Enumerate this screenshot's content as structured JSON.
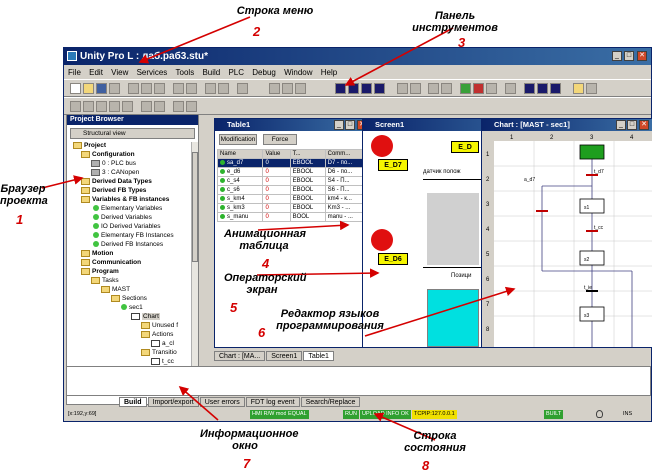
{
  "annotations": {
    "menu": {
      "label": "Строка меню",
      "num": "2"
    },
    "toolbar": {
      "label_line1": "Панель",
      "label_line2": "инструментов",
      "num": "3"
    },
    "browser": {
      "label_line1": "Браузер",
      "label_line2": "проекта",
      "num": "1"
    },
    "anim_table": {
      "label_line1": "Анимационная",
      "label_line2": "таблица",
      "num": "4"
    },
    "operator": {
      "label_line1": "Операторский",
      "label_line2": "экран",
      "num": "5"
    },
    "editor": {
      "label_line1": "Редактор языков",
      "label_line2": "программирования",
      "num": "6"
    },
    "info": {
      "label_line1": "Информационное",
      "label_line2": "окно",
      "num": "7"
    },
    "status": {
      "label_line1": "Строка",
      "label_line2": "состояния",
      "num": "8"
    }
  },
  "app": {
    "title": "Unity Pro L : лаб.раб3.stu*",
    "menu": [
      "File",
      "Edit",
      "View",
      "Services",
      "Tools",
      "Build",
      "PLC",
      "Debug",
      "Window",
      "Help"
    ]
  },
  "browser": {
    "title": "Project Browser",
    "view_label": "Structural view",
    "tree": [
      {
        "label": "Project",
        "bold": true
      },
      {
        "label": "Configuration",
        "bold": true
      },
      {
        "label": "0 : PLC bus",
        "bold": false
      },
      {
        "label": "3 : CANopen",
        "bold": false
      },
      {
        "label": "Derived Data Types",
        "bold": true
      },
      {
        "label": "Derived FB Types",
        "bold": true
      },
      {
        "label": "Variables & FB instances",
        "bold": true
      },
      {
        "label": "Elementary Variables",
        "bold": false
      },
      {
        "label": "Derived Variables",
        "bold": false
      },
      {
        "label": "IO Derived Variables",
        "bold": false
      },
      {
        "label": "Elementary FB Instances",
        "bold": false
      },
      {
        "label": "Derived FB Instances",
        "bold": false
      },
      {
        "label": "Motion",
        "bold": true
      },
      {
        "label": "Communication",
        "bold": true
      },
      {
        "label": "Program",
        "bold": true
      },
      {
        "label": "Tasks",
        "bold": false
      },
      {
        "label": "MAST",
        "bold": false
      },
      {
        "label": "Sections",
        "bold": false
      },
      {
        "label": "sec1",
        "bold": false
      },
      {
        "label": "Chart",
        "bold": false
      },
      {
        "label": "Unused f",
        "bold": false
      },
      {
        "label": "Actions",
        "bold": false
      },
      {
        "label": "a_cl",
        "bold": false
      },
      {
        "label": "Transitio",
        "bold": false
      },
      {
        "label": "t_cc",
        "bold": false
      }
    ]
  },
  "table1": {
    "title": "Table1",
    "btn_modification": "Modification",
    "btn_force": "Force",
    "headers": [
      "Name",
      "Value",
      "T...",
      "Comm..."
    ],
    "rows": [
      [
        "sa_d7",
        "0",
        "EBOOL",
        "D7 - по..."
      ],
      [
        "e_d6",
        "0",
        "EBOOL",
        "D6 - по..."
      ],
      [
        "c_s4",
        "0",
        "EBOOL",
        "S4 - П..."
      ],
      [
        "c_s6",
        "0",
        "EBOOL",
        "S6 - П..."
      ],
      [
        "s_km4",
        "0",
        "EBOOL",
        "km4 - к..."
      ],
      [
        "s_km3",
        "0",
        "EBOOL",
        "Km3 - ..."
      ],
      [
        "s_manu",
        "0",
        "BOOL",
        "manu - ..."
      ]
    ]
  },
  "screen1": {
    "title": "Screen1",
    "label_e_d7": "E_D7",
    "label_e_d6": "E_D6",
    "label_e_d": "E_D",
    "text_sensor": "датчик полож",
    "text_pos": "Позици"
  },
  "chart": {
    "title": "Chart : [MAST - sec1]",
    "cols": [
      "1",
      "2",
      "3",
      "4",
      "5"
    ],
    "rows": [
      "1",
      "2",
      "3",
      "4",
      "5",
      "6",
      "7",
      "8"
    ],
    "labels": {
      "t_d7": "t_d7",
      "a_d7": "a_d7",
      "t_cc": "t_cc",
      "t_ie": "t_ie",
      "s1": "s1",
      "s2": "s2",
      "s3": "s3"
    }
  },
  "doc_tabs": [
    "Chart : [MA...",
    "Screen1",
    "Table1"
  ],
  "output_tabs": [
    "Build",
    "Import/export",
    "User errors",
    "FDT log event",
    "Search/Replace"
  ],
  "status": {
    "coords": "[x:192,y:69]",
    "hmi": "HMI R/W mode",
    "equal": "EQUAL",
    "run": "RUN",
    "upload": "UPLOAD INFO OK",
    "tcpip": "TCPIP:127.0.0.1",
    "built": "BUILT",
    "ins": "INS"
  }
}
